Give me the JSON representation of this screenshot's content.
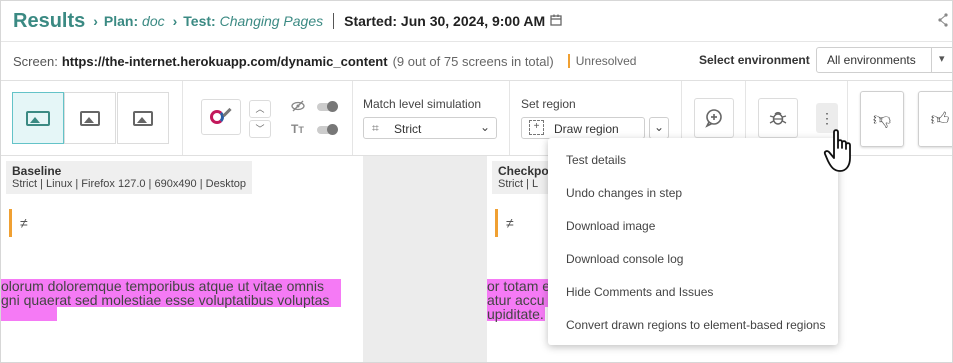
{
  "header": {
    "results": "Results",
    "plan_prefix": "Plan:",
    "plan_name": "doc",
    "test_prefix": "Test:",
    "test_name": "Changing Pages",
    "started": "Started: Jun 30, 2024, 9:00 AM"
  },
  "screen_bar": {
    "label": "Screen:",
    "url": "https://the-internet.herokuapp.com/dynamic_content",
    "count": "(9 out of 75 screens in total)",
    "status": "Unresolved",
    "env_label": "Select environment",
    "env_value": "All environments"
  },
  "toolbar": {
    "match_label": "Match level simulation",
    "match_value": "Strict",
    "region_label": "Set region",
    "region_value": "Draw region"
  },
  "baseline": {
    "title": "Baseline",
    "meta": "Strict  |  Linux  |  Firefox 127.0  |  690x490  |  Desktop",
    "line1": "olorum doloremque temporibus atque ut vitae omnis",
    "line2": "gni quaerat sed molestiae esse voluptatibus voluptas"
  },
  "checkpoint": {
    "title": "Checkpoi",
    "meta": "Strict  |  L",
    "line1": "or totam e",
    "line2": "atur accu",
    "line3": "upiditate."
  },
  "menu": {
    "items": [
      "Test details",
      "Undo changes in step",
      "Download image",
      "Download console log",
      "Hide Comments and Issues",
      "Convert drawn regions to element-based regions"
    ]
  },
  "colors": {
    "accent": "#3b8a83",
    "highlight": "#f57af5",
    "status": "#f0a032"
  }
}
